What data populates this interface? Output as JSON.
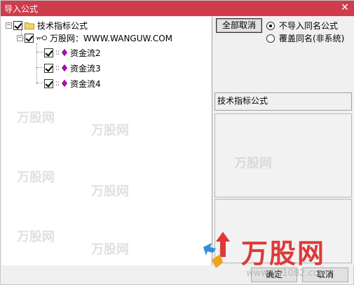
{
  "window": {
    "title": "导入公式"
  },
  "tree": {
    "root": {
      "label": "技术指标公式",
      "checked": true
    },
    "source": {
      "label": "万股网：WWW.WANGUW.COM",
      "checked": true
    },
    "items": [
      {
        "label": "资金流2",
        "checked": true
      },
      {
        "label": "资金流3",
        "checked": true
      },
      {
        "label": "资金流4",
        "checked": true
      }
    ]
  },
  "options": {
    "deselect_all": "全部取消",
    "radio_skip_same": "不导入同名公式",
    "radio_overwrite": "覆盖同名(非系统)",
    "selected": "skip_same"
  },
  "info": {
    "category_label": "技术指标公式"
  },
  "footer": {
    "ok_label": "确定",
    "cancel_label": "取消"
  },
  "watermark": {
    "brand": "万股网",
    "url": "www.991082.com"
  },
  "colors": {
    "titlebar": "#cf3c4c",
    "accent_gem": "#c000c0",
    "folder": "#f5d36b"
  }
}
